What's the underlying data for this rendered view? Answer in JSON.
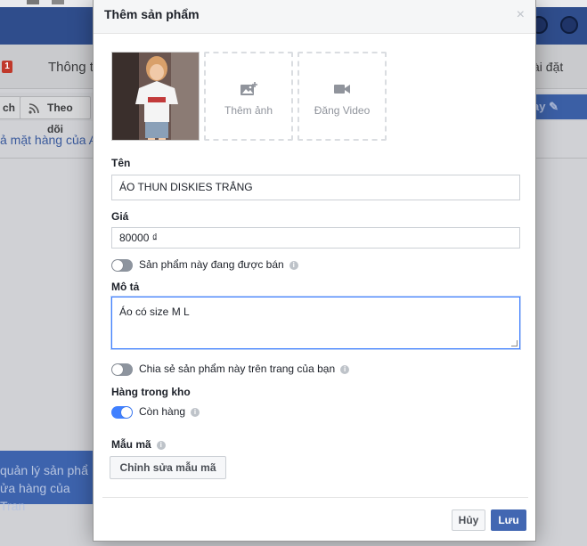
{
  "background": {
    "nav_badge": "1",
    "nav_left": "Thông t",
    "nav_right": "ài đặt",
    "action_left": "ch",
    "follow_label": "Theo dõi",
    "blue_pill": "ay",
    "blue_link": "ả mặt hàng của A",
    "promo_line1": "quản lý sản phẩ",
    "promo_line2": "ửa hàng của Tran"
  },
  "modal": {
    "title": "Thêm sản phẩm",
    "close_icon": "×",
    "add_photo_label": "Thêm ảnh",
    "upload_video_label": "Đăng Video",
    "name_label": "Tên",
    "name_value": "ÁO THUN DISKIES TRẮNG",
    "price_label": "Giá",
    "price_value": "80000 ₫",
    "on_sale_label": "Sản phẩm này đang được bán",
    "on_sale_enabled": false,
    "description_label": "Mô tả",
    "description_value": "Áo có size M L",
    "share_label": "Chia sẻ sản phẩm này trên trang của bạn",
    "share_enabled": false,
    "inventory_label": "Hàng trong kho",
    "in_stock_label": "Còn hàng",
    "in_stock_enabled": true,
    "variants_label": "Mẫu mã",
    "edit_variants_button": "Chỉnh sửa mẫu mã",
    "cancel_button": "Hủy",
    "save_button": "Lưu",
    "info_glyph": "i"
  },
  "colors": {
    "primary_button": "#4267b2",
    "toggle_on": "#4080ff",
    "fb_bar": "#2f4d8c"
  }
}
